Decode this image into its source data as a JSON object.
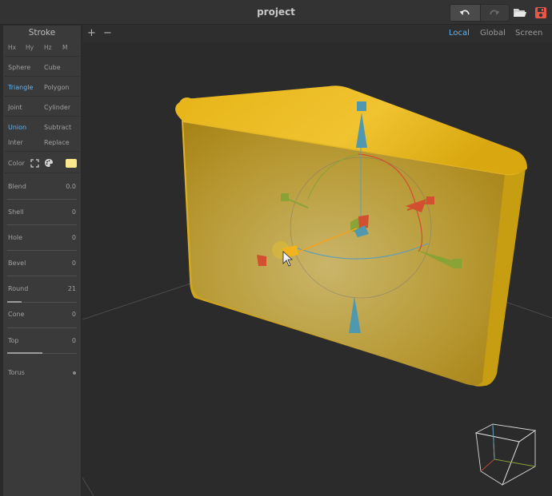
{
  "window": {
    "title": "project"
  },
  "toolbar_icons": {
    "undo": "undo-icon",
    "redo": "redo-icon",
    "open": "folder-icon",
    "save": "save-icon",
    "save_color": "#e6584a",
    "folder_color": "#cfcfcf"
  },
  "sidebar": {
    "heading": "Stroke",
    "axes": [
      "Hx",
      "Hy",
      "Hz",
      "M"
    ],
    "primitives": [
      [
        "Sphere",
        "Cube"
      ],
      [
        "Triangle",
        "Polygon"
      ],
      [
        "Joint",
        "Cylinder"
      ]
    ],
    "operations": [
      [
        "Union",
        "Subtract"
      ],
      [
        "Inter",
        "Replace"
      ]
    ],
    "selected_primitive": "Triangle",
    "selected_operation": "Union",
    "color_label": "Color",
    "color_value": "#f9e98c",
    "params": [
      {
        "label": "Blend",
        "value": "0.0",
        "level": 0
      },
      {
        "label": "Shell",
        "value": "0",
        "level": 0
      },
      {
        "label": "Hole",
        "value": "0",
        "level": 0
      },
      {
        "label": "Bevel",
        "value": "0",
        "level": 0
      },
      {
        "label": "Round",
        "value": "21",
        "level": 0.21
      },
      {
        "label": "Cone",
        "value": "0",
        "level": 0
      },
      {
        "label": "Top",
        "value": "0",
        "level": 0.5
      }
    ],
    "torus_label": "Torus"
  },
  "viewport": {
    "add_label": "+",
    "remove_label": "−",
    "spaces": [
      "Local",
      "Global",
      "Screen"
    ],
    "selected_space": "Local",
    "accent": "#63b3f0",
    "shape_color": "#e1b21c"
  }
}
